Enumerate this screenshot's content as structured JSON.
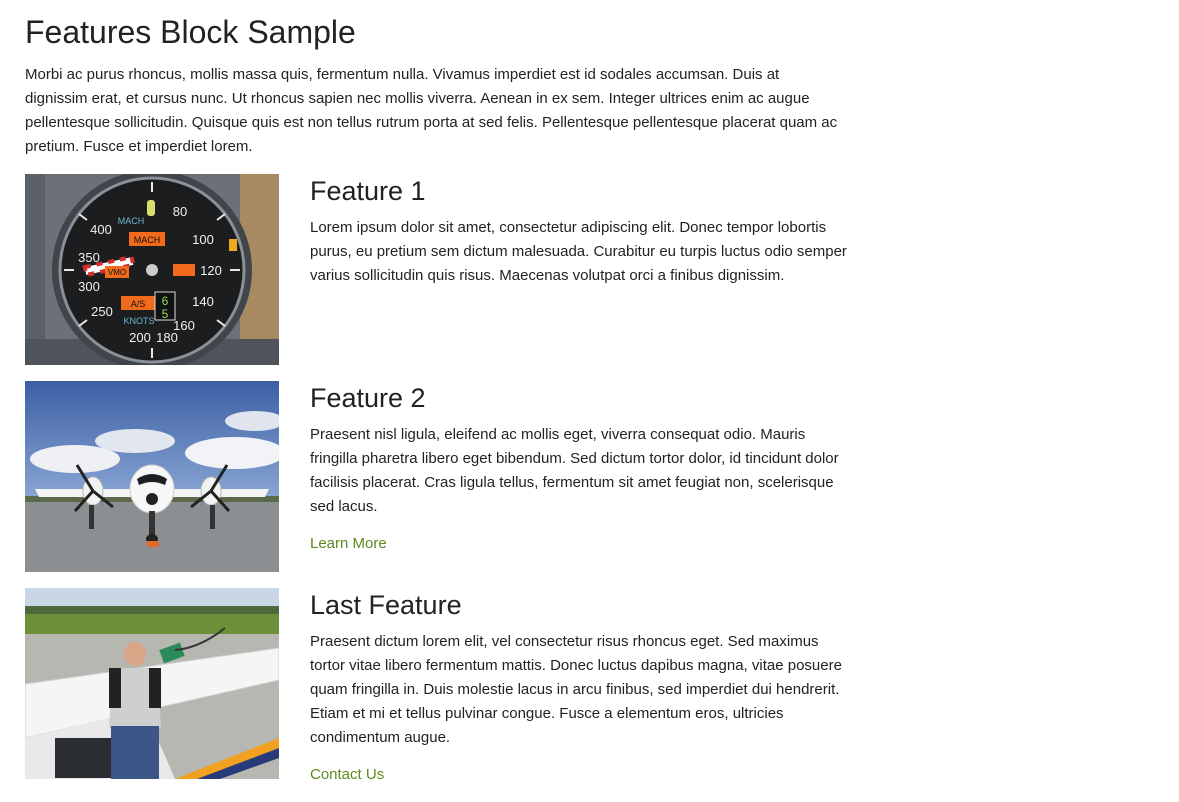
{
  "page": {
    "title": "Features Block Sample",
    "intro": "Morbi ac purus rhoncus, mollis massa quis, fermentum nulla. Vivamus imperdiet est id sodales accumsan. Duis at dignissim erat, et cursus nunc. Ut rhoncus sapien nec mollis viverra. Aenean in ex sem. Integer ultrices enim ac augue pellentesque sollicitudin. Quisque quis est non tellus rutrum porta at sed felis. Pellentesque pellentesque placerat quam ac pretium. Fusce et imperdiet lorem."
  },
  "features": [
    {
      "title": "Feature 1",
      "text": "Lorem ipsum dolor sit amet, consectetur adipiscing elit. Donec tempor lobortis purus, eu pretium sem dictum malesuada. Curabitur eu turpis luctus odio semper varius sollicitudin quis risus. Maecenas volutpat orci a finibus dignissim.",
      "image": "airspeed-indicator-photo",
      "gauge": {
        "numbers": [
          "80",
          "100",
          "120",
          "140",
          "160",
          "180",
          "200",
          "250",
          "300",
          "350",
          "400"
        ],
        "labels": [
          "MACH",
          "KNOTS",
          "MACH",
          "VMO",
          "A/S",
          "6",
          "5"
        ]
      }
    },
    {
      "title": "Feature 2",
      "text": "Praesent nisl ligula, eleifend ac mollis eget, viverra consequat odio. Mauris fringilla pharetra libero eget bibendum. Sed dictum tortor dolor, id tincidunt dolor facilisis placerat. Cras ligula tellus, fermentum sit amet feugiat non, scelerisque sed lacus.",
      "image": "twin-prop-airplane-photo",
      "link": "Learn More"
    },
    {
      "title": "Last Feature",
      "text": "Praesent dictum lorem elit, vel consectetur risus rhoncus eget. Sed maximus tortor vitae libero fermentum mattis. Donec luctus dapibus magna, vitae posuere quam fringilla in. Duis molestie lacus in arcu finibus, sed imperdiet dui hendrerit. Etiam et mi et tellus pulvinar congue. Fusce a elementum eros, ultricies condimentum augue.",
      "image": "refueling-plane-photo",
      "link": "Contact Us"
    }
  ],
  "colors": {
    "link": "#5f8a1e",
    "text": "#222222",
    "background": "#ffffff"
  }
}
